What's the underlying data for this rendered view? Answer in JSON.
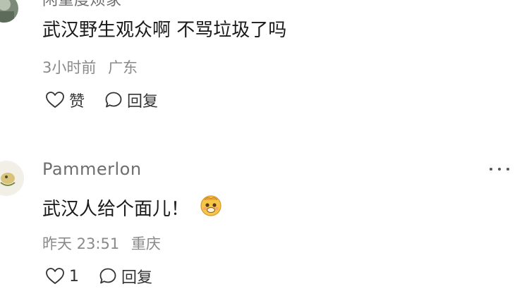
{
  "comments": [
    {
      "username": "闲重度烦家",
      "text": "武汉野生观众啊 不骂垃圾了吗",
      "time": "3小时前",
      "location": "广东",
      "like_label": "赞",
      "reply_label": "回复"
    },
    {
      "username": "Pammerlon",
      "text": "武汉人给个面儿！",
      "emoji": "smiling-face-emoji",
      "time": "昨天 23:51",
      "location": "重庆",
      "like_label": "1",
      "reply_label": "回复"
    }
  ],
  "icons": {
    "like": "heart-outline-icon",
    "reply": "speech-bubble-icon",
    "more": "more-dots-icon"
  },
  "colors": {
    "username": "#6e6e6e",
    "meta": "#8a8a8a",
    "text": "#1a1a1a",
    "divider": "#e8e8e8"
  }
}
